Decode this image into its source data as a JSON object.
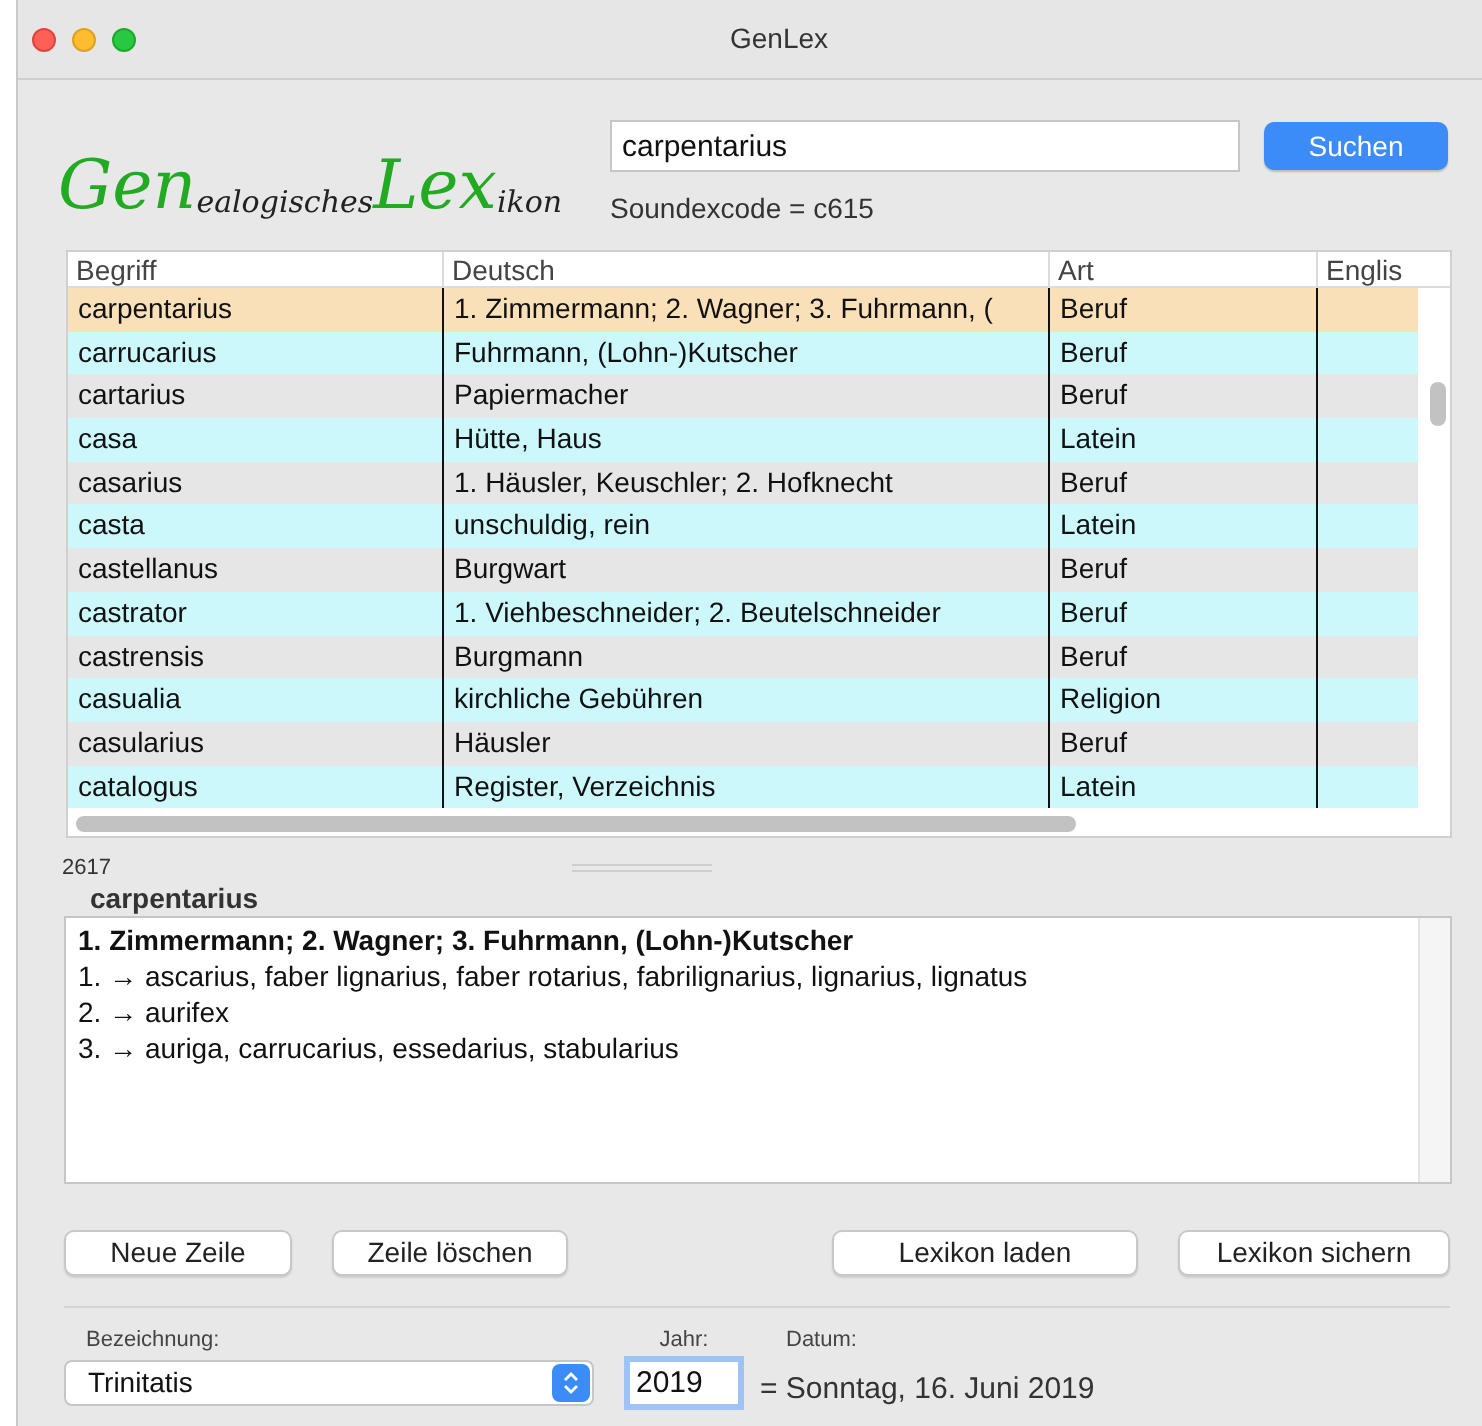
{
  "window": {
    "title": "GenLex"
  },
  "logo": [
    {
      "text": "Gen",
      "kind": "accent"
    },
    {
      "text": "ealogisches",
      "kind": "plain"
    },
    {
      "text": "Lex",
      "kind": "accent"
    },
    {
      "text": "ikon",
      "kind": "plain"
    }
  ],
  "search": {
    "value": "carpentarius",
    "button": "Suchen",
    "soundex": "Soundexcode = c615"
  },
  "table": {
    "columns": [
      "Begriff",
      "Deutsch",
      "Art",
      "Englis"
    ],
    "rows": [
      {
        "cells": [
          "carpentarius",
          "1. Zimmermann; 2. Wagner; 3. Fuhrmann, (",
          "Beruf",
          ""
        ],
        "selected": true
      },
      {
        "cells": [
          "carrucarius",
          "Fuhrmann, (Lohn-)Kutscher",
          "Beruf",
          ""
        ],
        "selected": false
      },
      {
        "cells": [
          "cartarius",
          "Papiermacher",
          "Beruf",
          ""
        ],
        "selected": false
      },
      {
        "cells": [
          "casa",
          "Hütte, Haus",
          "Latein",
          ""
        ],
        "selected": false
      },
      {
        "cells": [
          "casarius",
          "1. Häusler, Keuschler; 2. Hofknecht",
          "Beruf",
          ""
        ],
        "selected": false
      },
      {
        "cells": [
          "casta",
          "unschuldig, rein",
          "Latein",
          ""
        ],
        "selected": false
      },
      {
        "cells": [
          "castellanus",
          "Burgwart",
          "Beruf",
          ""
        ],
        "selected": false
      },
      {
        "cells": [
          "castrator",
          "1. Viehbeschneider; 2. Beutelschneider",
          "Beruf",
          ""
        ],
        "selected": false
      },
      {
        "cells": [
          "castrensis",
          "Burgmann",
          "Beruf",
          ""
        ],
        "selected": false
      },
      {
        "cells": [
          "casualia",
          "kirchliche Gebühren",
          "Religion",
          ""
        ],
        "selected": false
      },
      {
        "cells": [
          "casularius",
          "Häusler",
          "Beruf",
          ""
        ],
        "selected": false
      },
      {
        "cells": [
          "catalogus",
          "Register, Verzeichnis",
          "Latein",
          ""
        ],
        "selected": false
      }
    ]
  },
  "count": "2617",
  "detail": {
    "term": "carpentarius",
    "lines": [
      {
        "text": "1. Zimmermann; 2. Wagner; 3. Fuhrmann, (Lohn-)Kutscher",
        "kind": "heading"
      },
      {
        "text": "1. → ascarius, faber lignarius, faber rotarius, fabrilignarius, lignarius, lignatus",
        "kind": "plain"
      },
      {
        "text": "2. → aurifex",
        "kind": "plain"
      },
      {
        "text": "3. → auriga, carrucarius, essedarius, stabularius",
        "kind": "plain"
      }
    ]
  },
  "buttons_left": [
    "Neue Zeile",
    "Zeile löschen"
  ],
  "buttons_right": [
    "Lexikon laden",
    "Lexikon sichern"
  ],
  "bottom": {
    "bezeichnung_label": "Bezeichnung:",
    "bezeichnung": "Trinitatis",
    "jahr_label": "Jahr:",
    "jahr": "2019",
    "datum_label": "Datum:",
    "datum": "= Sonntag, 16. Juni 2019"
  }
}
